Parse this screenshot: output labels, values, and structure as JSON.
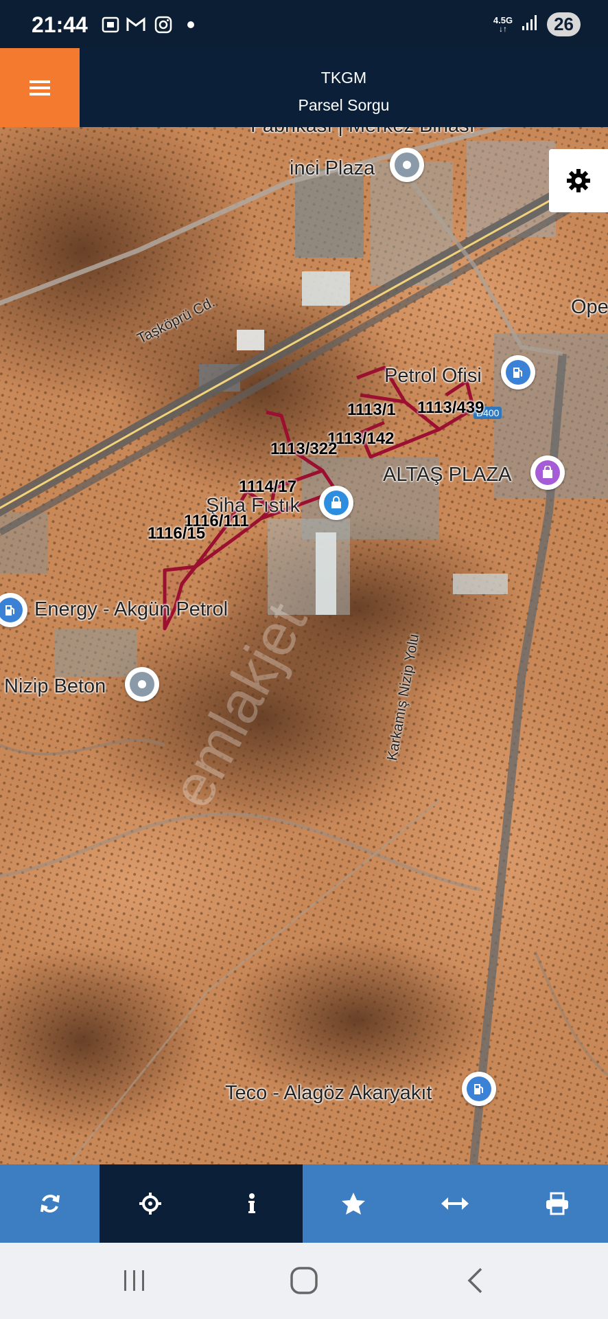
{
  "status_bar": {
    "time": "21:44",
    "network": "4.5G",
    "battery": "26",
    "notification_icons": [
      "screenshot-icon",
      "gmail-icon",
      "instagram-icon",
      "dot-icon"
    ]
  },
  "header": {
    "title": "TKGM",
    "subtitle": "Parsel Sorgu"
  },
  "map": {
    "watermark": "emlakjet",
    "road_labels": {
      "taskopru": "Taşköprü Cd.",
      "karkamis": "Karkamış Nizip Yolu",
      "d400": "D400"
    },
    "places": {
      "top_cut": "Fabrikası | Merkez Binası",
      "inci_plaza": "inci Plaza",
      "ope": "Ope",
      "petrol_ofisi": "Petrol Ofisi",
      "altas_plaza": "ALTAŞ PLAZA",
      "siha_fistik": "Şiha Fıstık",
      "energy": "Energy - Akgün Petrol",
      "nizip_beton": "Nizip Beton",
      "teco": "Teco - Alagöz Akaryakıt"
    },
    "parcels": {
      "p1": "1113/1",
      "p2": "1113/439",
      "p3": "1113/142",
      "p4": "1113/322",
      "p5": "1114/17",
      "p6": "1116/111",
      "p7": "1116/15"
    }
  },
  "toolbar": {
    "buttons": [
      "refresh-icon",
      "locate-icon",
      "info-icon",
      "star-icon",
      "measure-icon",
      "print-icon"
    ],
    "colors": {
      "blue": "#3d7ec2",
      "dark": "#0b2038"
    }
  },
  "colors": {
    "header_bg": "#0b2038",
    "menu_bg": "#f47a2f",
    "parcel_outline": "#9b1030"
  }
}
